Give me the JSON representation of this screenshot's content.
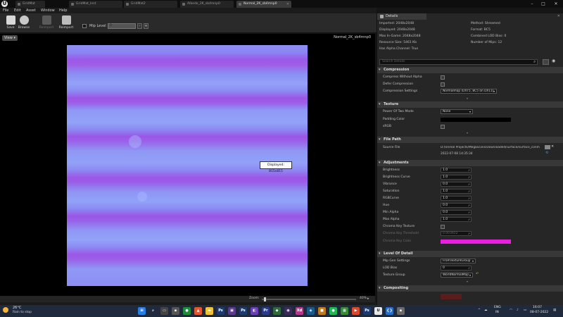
{
  "tabs": [
    {
      "label": "GridMat"
    },
    {
      "label": "GridMat_Inst"
    },
    {
      "label": "GridMat2"
    },
    {
      "label": "Albedo_2K_sb4mnp0"
    },
    {
      "label": "Normal_2K_sb4mnp0",
      "active": true
    }
  ],
  "window_controls": {
    "minimize": "–",
    "maximize": "□",
    "close": "✕"
  },
  "menu": [
    "File",
    "Edit",
    "Asset",
    "Window",
    "Help"
  ],
  "toolbar": {
    "save": "Save",
    "browse": "Browse",
    "reimport_disabled": "Reimport",
    "reimport": "Reimport",
    "mip_level_label": "Mip Level",
    "mip_level_value": "0",
    "mip_minus": "-",
    "mip_plus": "+"
  },
  "viewport": {
    "view_button": "View ▾",
    "texture_name": "Normal_2K_sb4mnp0",
    "tooltip": "Displayed: 815x815",
    "zoom_label": "Zoom:",
    "zoom_value": "40%",
    "zoom_fraction": 0.02
  },
  "details": {
    "tab_label": "Details",
    "info_left": [
      "Imported: 2048x2048",
      "Displayed: 2048x2048",
      "Max In-Game: 2048x2048",
      "Resource Size: 5461 Kb",
      "Has Alpha Channel: True"
    ],
    "info_right": [
      "Method: Streamed",
      "Format: BC5",
      "Combined LOD Bias: 0",
      "Number of Mips: 12"
    ],
    "search_placeholder": "Search Details",
    "sections": {
      "compression": {
        "title": "Compression",
        "props": {
          "compress_without_alpha": "Compress Without Alpha",
          "defer_compression": "Defer Compression",
          "compression_settings": "Compression Settings",
          "compression_settings_value": "Normalmap (DXT5, BC5 on DX11)"
        }
      },
      "texture": {
        "title": "Texture",
        "props": {
          "power_of_two_mode": "Power Of Two Mode",
          "power_of_two_value": "None",
          "padding_color": "Padding Color",
          "srgb": "sRGB"
        }
      },
      "file_path": {
        "title": "File Path",
        "source_file_label": "Source File",
        "source_file_value": "D:/Unreal Projects/Megascans/Downloaded/surface/surface_conm",
        "source_file_date": "2022-07-08 14:35:34"
      },
      "adjustments": {
        "title": "Adjustments",
        "rows": [
          {
            "label": "Brightness",
            "value": "1.0"
          },
          {
            "label": "Brightness Curve",
            "value": "1.0"
          },
          {
            "label": "Vibrance",
            "value": "0.0"
          },
          {
            "label": "Saturation",
            "value": "1.0"
          },
          {
            "label": "RGBCurve",
            "value": "1.0"
          },
          {
            "label": "Hue",
            "value": "0.0"
          },
          {
            "label": "Min Alpha",
            "value": "0.0"
          },
          {
            "label": "Max Alpha",
            "value": "1.0"
          }
        ],
        "chroma_key_texture": "Chroma Key Texture",
        "chroma_key_threshold": "Chroma Key Threshold",
        "chroma_key_threshold_value": "0.003922",
        "chroma_key_color": "Chroma Key Color",
        "chroma_key_color_hex": "#e91ee0"
      },
      "level_of_detail": {
        "title": "Level Of Detail",
        "mip_gen_settings": "Mip Gen Settings",
        "mip_gen_value": "FromTextureGroup",
        "lod_bias": "LOD Bias",
        "lod_bias_value": "0",
        "texture_group": "Texture Group",
        "texture_group_value": "WorldNormalMap"
      },
      "compositing": {
        "title": "Compositing"
      }
    }
  },
  "taskbar": {
    "weather_temp": "26°C",
    "weather_desc": "Rain to stop",
    "lang_top": "ENG",
    "lang_bottom": "IN",
    "time": "16:07",
    "date": "08-07-2022"
  },
  "colors": {
    "padding_color": "#000000",
    "chroma_key_color": "#e91ee0"
  }
}
